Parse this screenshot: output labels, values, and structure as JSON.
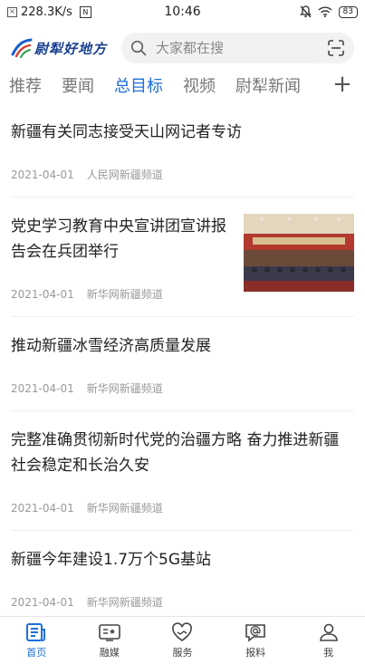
{
  "status": {
    "speed": "228.3K/s",
    "n_badge": "N",
    "time": "10:46",
    "battery": "83"
  },
  "header": {
    "logo_text": "尉犁好地方",
    "search_placeholder": "大家都在搜"
  },
  "tabs": [
    {
      "label": "推荐"
    },
    {
      "label": "要闻"
    },
    {
      "label": "总目标"
    },
    {
      "label": "视频"
    },
    {
      "label": "尉犁新闻"
    }
  ],
  "active_tab": 2,
  "news": [
    {
      "title": "新疆有关同志接受天山网记者专访",
      "date": "2021-04-01",
      "source": "人民网新疆频道"
    },
    {
      "title": "党史学习教育中央宣讲团宣讲报告会在兵团举行",
      "date": "2021-04-01",
      "source": "新华网新疆频道"
    },
    {
      "title": "推动新疆冰雪经济高质量发展",
      "date": "2021-04-01",
      "source": "新华网新疆频道"
    },
    {
      "title": "完整准确贯彻新时代党的治疆方略 奋力推进新疆社会稳定和长治久安",
      "date": "2021-04-01",
      "source": "新华网新疆频道"
    },
    {
      "title": "新疆今年建设1.7万个5G基站",
      "date": "2021-04-01",
      "source": "新华网新疆频道"
    }
  ],
  "bottom_nav": [
    {
      "label": "首页"
    },
    {
      "label": "融媒"
    },
    {
      "label": "服务"
    },
    {
      "label": "报料"
    },
    {
      "label": "我"
    }
  ],
  "colors": {
    "accent": "#1e6fd9",
    "logo": "#1a3f8f"
  }
}
